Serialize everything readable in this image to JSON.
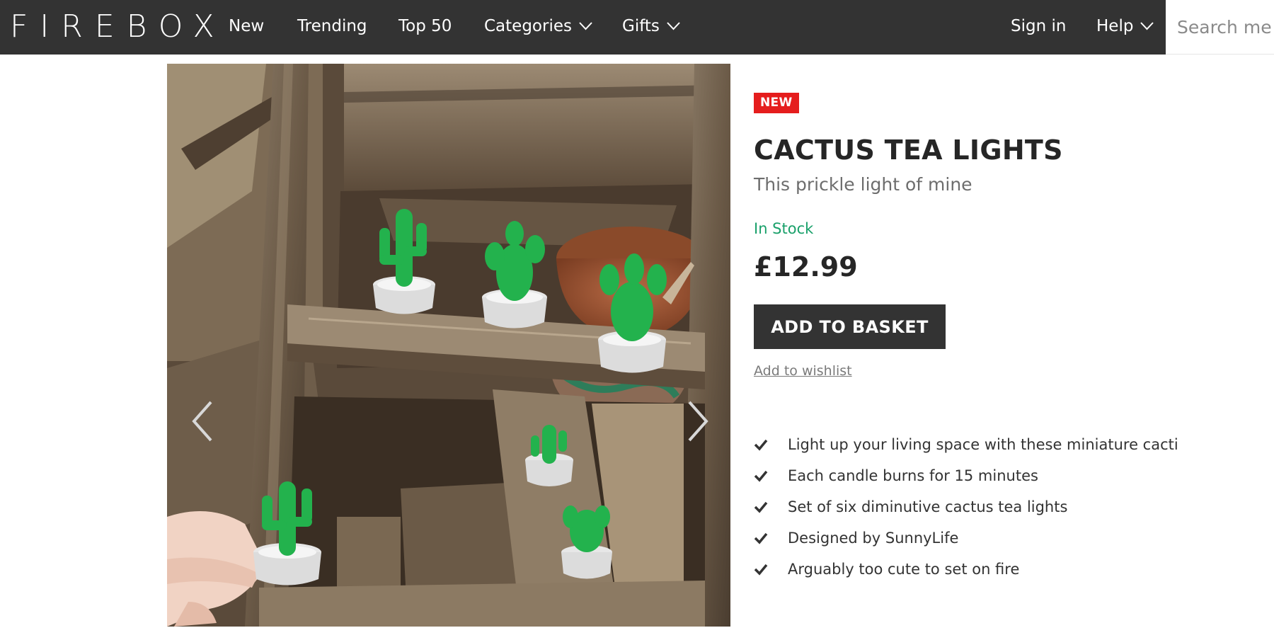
{
  "brand": {
    "logo_text": "FIREBOX"
  },
  "nav": {
    "items": [
      {
        "label": "New"
      },
      {
        "label": "Trending"
      },
      {
        "label": "Top 50"
      },
      {
        "label": "Categories",
        "dropdown": true
      },
      {
        "label": "Gifts",
        "dropdown": true
      }
    ],
    "sign_in": "Sign in",
    "help": "Help",
    "search_placeholder": "Search me"
  },
  "gallery": {
    "prev_icon": "chevron-left-icon",
    "next_icon": "chevron-right-icon"
  },
  "product": {
    "badge": "NEW",
    "title": "CACTUS TEA LIGHTS",
    "subtitle": "This prickle light of mine",
    "stock_status": "In Stock",
    "price": "£12.99",
    "add_to_basket": "ADD TO BASKET",
    "add_to_wishlist": "Add to wishlist",
    "features": [
      "Light up your living space with these miniature cacti",
      "Each candle burns for 15 minutes",
      "Set of six diminutive cactus tea lights",
      "Designed by SunnyLife",
      "Arguably too cute to set on fire"
    ]
  },
  "colors": {
    "nav_bg": "#333333",
    "badge_red": "#e51d1d",
    "stock_green": "#19a06a",
    "button_dark": "#333333",
    "cactus_green": "#22b24c"
  }
}
